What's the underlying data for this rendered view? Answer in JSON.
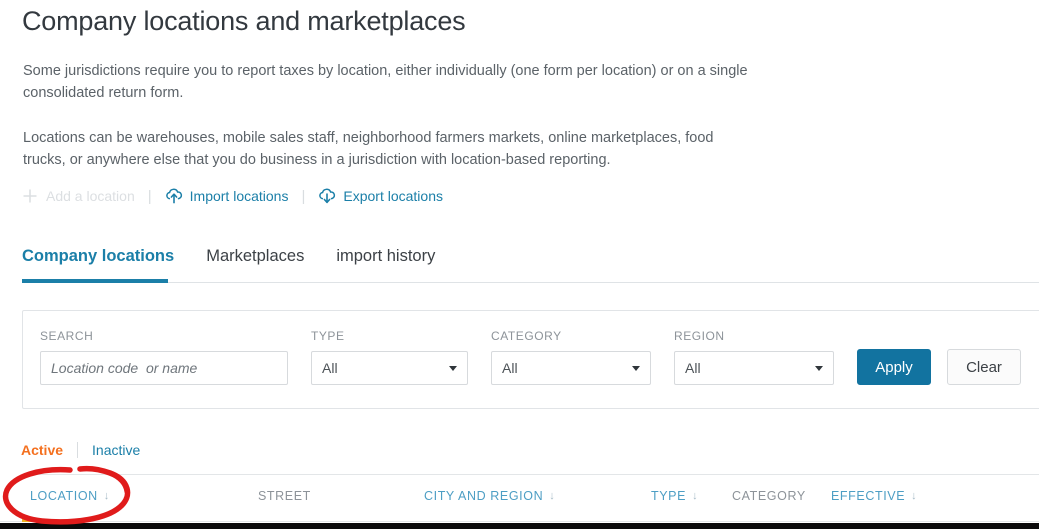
{
  "page": {
    "title": "Company locations and marketplaces",
    "intro_paragraph_1": "Some jurisdictions require you to report taxes by location, either individually (one form per location) or on a single consolidated return form.",
    "intro_paragraph_2": "Locations can be warehouses, mobile sales staff, neighborhood farmers markets, online marketplaces, food trucks, or anywhere else that you do business in a jurisdiction with location-based reporting."
  },
  "actions": [
    {
      "label": "Add a location",
      "icon": "plus-icon",
      "state": "disabled"
    },
    {
      "label": "Import locations",
      "icon": "cloud-upload-icon",
      "state": "enabled"
    },
    {
      "label": "Export locations",
      "icon": "cloud-download-icon",
      "state": "enabled"
    }
  ],
  "separator": "|",
  "tabs": [
    {
      "label": "Company locations",
      "active": true
    },
    {
      "label": "Marketplaces",
      "active": false
    },
    {
      "label": "import history",
      "active": false
    }
  ],
  "filters": {
    "search": {
      "label": "SEARCH",
      "placeholder": "Location code  or name",
      "value": ""
    },
    "type": {
      "label": "TYPE",
      "value": "All"
    },
    "category": {
      "label": "CATEGORY",
      "value": "All"
    },
    "region": {
      "label": "REGION",
      "value": "All"
    },
    "apply_label": "Apply",
    "clear_label": "Clear"
  },
  "state_toggle": {
    "active_label": "Active",
    "inactive_label": "Inactive"
  },
  "table": {
    "columns": [
      {
        "label": "LOCATION",
        "sortable": true,
        "sort_icon": "↓"
      },
      {
        "label": "STREET",
        "sortable": false,
        "sort_icon": ""
      },
      {
        "label": "CITY AND REGION",
        "sortable": true,
        "sort_icon": "↓"
      },
      {
        "label": "TYPE",
        "sortable": true,
        "sort_icon": "↓"
      },
      {
        "label": "CATEGORY",
        "sortable": false,
        "sort_icon": ""
      },
      {
        "label": "EFFECTIVE",
        "sortable": true,
        "sort_icon": "↓"
      }
    ]
  },
  "annotation": {
    "shape": "ellipse",
    "color": "#e01b1b",
    "target": "LOCATION"
  },
  "colors": {
    "link_blue": "#1b7fa8",
    "accent_blue": "#1273a0",
    "header_blue": "#4d9ec4",
    "active_orange": "#f4701f",
    "row_accent": "#f0b323",
    "annotation_red": "#e01b1b"
  }
}
